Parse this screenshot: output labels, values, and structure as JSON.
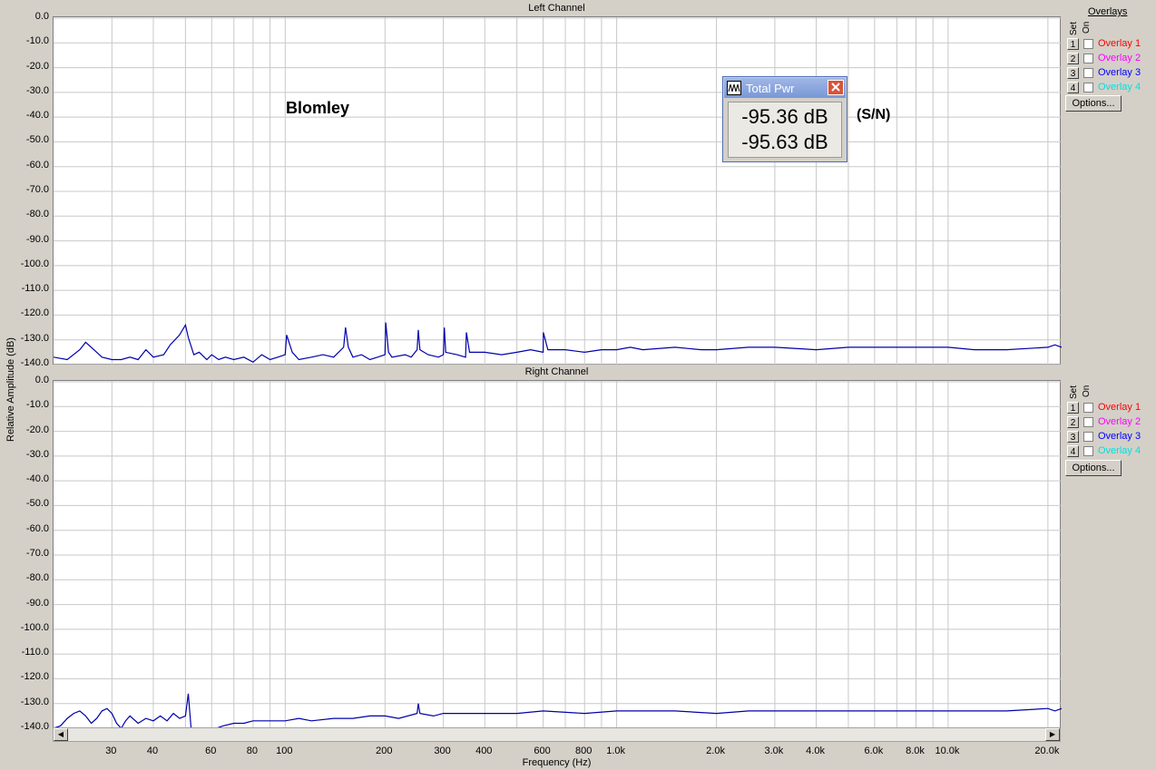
{
  "chart_data": [
    {
      "type": "line",
      "title": "Left Channel",
      "xlabel": "Frequency (Hz)",
      "ylabel": "Relative Amplitude (dB)",
      "x_scale": "log",
      "xlim": [
        20,
        22000
      ],
      "ylim": [
        -140,
        0
      ],
      "grid": true,
      "y_ticks": [
        "0.0",
        "-10.0",
        "-20.0",
        "-30.0",
        "-40.0",
        "-50.0",
        "-60.0",
        "-70.0",
        "-80.0",
        "-90.0",
        "-100.0",
        "-110.0",
        "-120.0",
        "-130.0",
        "-140.0"
      ],
      "x_ticks": [
        "30",
        "40",
        "60",
        "80",
        "100",
        "200",
        "300",
        "400",
        "600",
        "800",
        "1.0k",
        "2.0k",
        "3.0k",
        "4.0k",
        "6.0k",
        "8.0k",
        "10.0k",
        "20.0k"
      ],
      "color": "#0000aa",
      "series": [
        {
          "x": [
            20,
            22,
            24,
            25,
            27,
            28,
            30,
            32,
            34,
            36,
            38,
            40,
            43,
            45,
            48,
            50,
            51,
            53,
            55,
            58,
            60,
            63,
            66,
            70,
            75,
            80,
            85,
            90,
            95,
            100,
            101,
            105,
            110,
            120,
            130,
            140,
            150,
            152,
            155,
            160,
            170,
            180,
            190,
            200,
            201,
            205,
            210,
            230,
            240,
            250,
            252,
            255,
            270,
            290,
            300,
            302,
            305,
            330,
            350,
            352,
            360,
            400,
            450,
            500,
            550,
            600,
            601,
            620,
            700,
            800,
            900,
            1000,
            1100,
            1200,
            1500,
            1800,
            2000,
            2500,
            3000,
            4000,
            5000,
            6000,
            8000,
            10000,
            12000,
            15000,
            20000,
            21000,
            22000
          ],
          "y": [
            -137,
            -138,
            -134,
            -131,
            -135,
            -137,
            -138,
            -138,
            -137,
            -138,
            -134,
            -137,
            -136,
            -132,
            -128,
            -124,
            -129,
            -136,
            -135,
            -138,
            -136,
            -138,
            -137,
            -138,
            -137,
            -139,
            -136,
            -138,
            -137,
            -136,
            -128,
            -135,
            -138,
            -137,
            -136,
            -137,
            -133,
            -125,
            -133,
            -137,
            -136,
            -138,
            -137,
            -136,
            -123,
            -135,
            -137,
            -136,
            -137,
            -134,
            -126,
            -134,
            -136,
            -137,
            -136,
            -125,
            -135,
            -136,
            -137,
            -127,
            -135,
            -135,
            -136,
            -135,
            -134,
            -135,
            -127,
            -134,
            -134,
            -135,
            -134,
            -134,
            -133,
            -134,
            -133,
            -134,
            -134,
            -133,
            -133,
            -134,
            -133,
            -133,
            -133,
            -133,
            -134,
            -134,
            -133,
            -132,
            -133
          ]
        }
      ]
    },
    {
      "type": "line",
      "title": "Right Channel",
      "xlabel": "Frequency (Hz)",
      "ylabel": "Relative Amplitude (dB)",
      "x_scale": "log",
      "xlim": [
        20,
        22000
      ],
      "ylim": [
        -140,
        0
      ],
      "grid": true,
      "y_ticks": [
        "0.0",
        "-10.0",
        "-20.0",
        "-30.0",
        "-40.0",
        "-50.0",
        "-60.0",
        "-70.0",
        "-80.0",
        "-90.0",
        "-100.0",
        "-110.0",
        "-120.0",
        "-130.0",
        "-140.0"
      ],
      "x_ticks": [
        "30",
        "40",
        "60",
        "80",
        "100",
        "200",
        "300",
        "400",
        "600",
        "800",
        "1.0k",
        "2.0k",
        "3.0k",
        "4.0k",
        "6.0k",
        "8.0k",
        "10.0k",
        "20.0k"
      ],
      "color": "#0000aa",
      "series": [
        {
          "x": [
            20,
            21,
            22,
            23,
            24,
            25,
            26,
            27,
            28,
            29,
            30,
            31,
            32,
            33,
            34,
            36,
            38,
            40,
            42,
            44,
            46,
            48,
            50,
            51,
            52,
            54,
            58,
            62,
            65,
            70,
            75,
            80,
            90,
            100,
            110,
            120,
            140,
            160,
            180,
            200,
            220,
            250,
            252,
            255,
            280,
            300,
            350,
            400,
            500,
            600,
            800,
            1000,
            1200,
            1500,
            2000,
            2500,
            3000,
            4000,
            5000,
            6000,
            8000,
            10000,
            15000,
            20000,
            21000,
            22000
          ],
          "y": [
            -140,
            -139,
            -136,
            -134,
            -133,
            -135,
            -138,
            -136,
            -133,
            -132,
            -134,
            -138,
            -140,
            -137,
            -135,
            -138,
            -136,
            -137,
            -135,
            -137,
            -134,
            -136,
            -135,
            -126,
            -140,
            -140,
            -140,
            -140,
            -139,
            -138,
            -138,
            -137,
            -137,
            -137,
            -136,
            -137,
            -136,
            -136,
            -135,
            -135,
            -136,
            -134,
            -130,
            -134,
            -135,
            -134,
            -134,
            -134,
            -134,
            -133,
            -134,
            -133,
            -133,
            -133,
            -134,
            -133,
            -133,
            -133,
            -133,
            -133,
            -133,
            -133,
            -133,
            -132,
            -133,
            -132
          ]
        }
      ]
    }
  ],
  "annotations": {
    "label": "Blomley",
    "sn": "(S/N)"
  },
  "total_pwr": {
    "title": "Total Pwr",
    "values": [
      "-95.36 dB",
      "-95.63 dB"
    ]
  },
  "side_panel": {
    "overlays_header": "Overlays",
    "set_label": "Set",
    "on_label": "On",
    "options_label": "Options...",
    "overlays": [
      {
        "num": "1",
        "label": "Overlay 1",
        "color": "#ff0000"
      },
      {
        "num": "2",
        "label": "Overlay 2",
        "color": "#ff00ff"
      },
      {
        "num": "3",
        "label": "Overlay 3",
        "color": "#0000ff"
      },
      {
        "num": "4",
        "label": "Overlay 4",
        "color": "#00e0e0"
      }
    ]
  }
}
